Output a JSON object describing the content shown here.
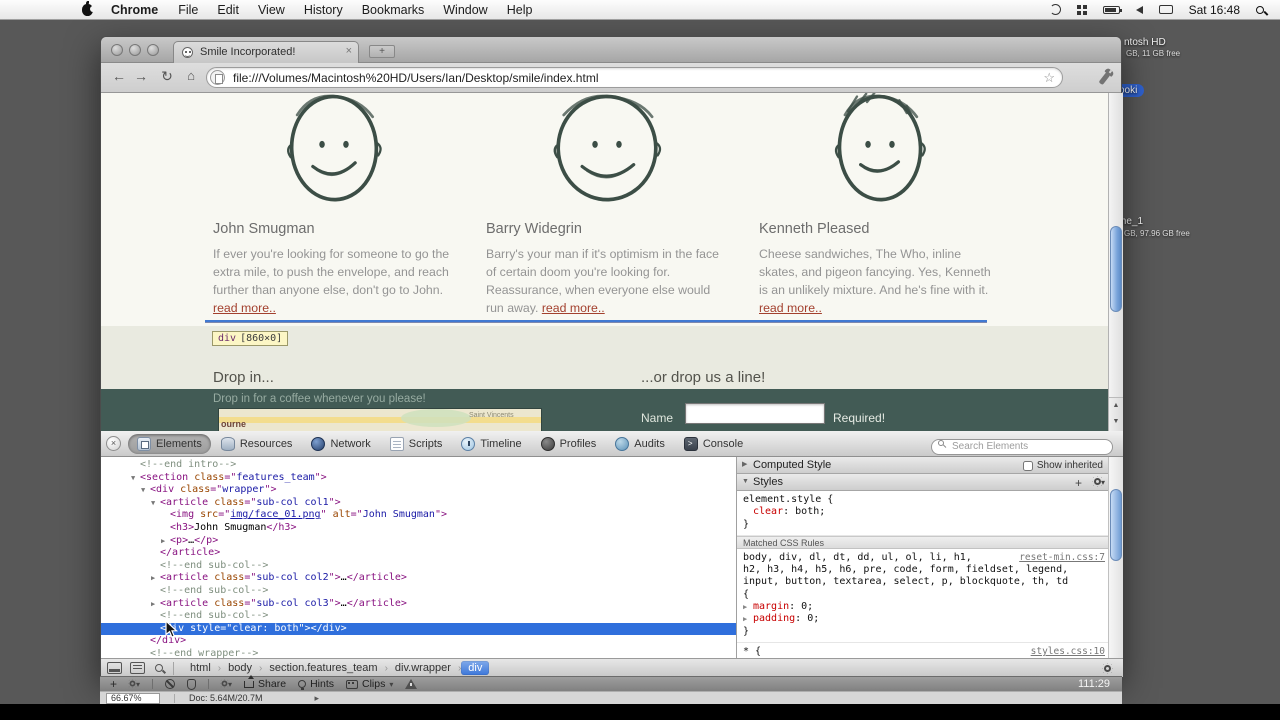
{
  "menubar": {
    "app": "Chrome",
    "menus": [
      "File",
      "Edit",
      "View",
      "History",
      "Bookmarks",
      "Window",
      "Help"
    ],
    "clock": "Sat 16:48"
  },
  "desktop": {
    "disk_top_label": "ntosh HD",
    "disk_top_info": "GB, 11 GB free",
    "selected_file_label": "ooki",
    "disk_bottom_label": "me_1",
    "disk_bottom_info": "GB, 97.96 GB free"
  },
  "window": {
    "tab_title": "Smile Incorporated!",
    "url": "file:///Volumes/Macintosh%20HD/Users/Ian/Desktop/smile/index.html"
  },
  "nav": {
    "back": "←",
    "forward": "→",
    "reload": "↻",
    "home": "⌂",
    "star": "☆"
  },
  "page": {
    "team": [
      {
        "name": "John Smugman",
        "bio": "If ever you're looking for someone to go the extra mile, to push the envelope, and reach further than anyone else, don't go to John. ",
        "more": "read more.."
      },
      {
        "name": "Barry Widegrin",
        "bio": "Barry's your man if it's optimism in the face of certain doom you're looking for. Reassurance, when everyone else would run away. ",
        "more": "read more.."
      },
      {
        "name": "Kenneth Pleased",
        "bio": "Cheese sandwiches, The Who, inline skates, and pigeon fancying. Yes, Kenneth is an unlikely mixture. And he's fine with it. ",
        "more": "read more.."
      }
    ],
    "highlight_tooltip": {
      "tag": "div",
      "size": "[860×0]"
    },
    "contact": {
      "left_heading": "Drop in...",
      "right_heading": "...or drop us a line!",
      "left_subtext": "Drop in for a coffee whenever you please!",
      "map_label_1": "Saint Vincents",
      "map_label_2": "ourne",
      "form_name_label": "Name",
      "form_required": "Required!"
    }
  },
  "devtools": {
    "tabs": [
      {
        "label": "Elements",
        "active": true
      },
      {
        "label": "Resources"
      },
      {
        "label": "Network"
      },
      {
        "label": "Scripts"
      },
      {
        "label": "Timeline"
      },
      {
        "label": "Profiles"
      },
      {
        "label": "Audits"
      },
      {
        "label": "Console"
      }
    ],
    "search_placeholder": "Search Elements",
    "tree": [
      {
        "i": 0,
        "p": [
          [
            "c",
            "<!--end intro-->"
          ]
        ]
      },
      {
        "i": 0,
        "a": "o",
        "p": [
          [
            "u",
            "<"
          ],
          [
            "g",
            "section"
          ],
          [
            "t",
            " "
          ],
          [
            "a",
            "class"
          ],
          [
            "u",
            "=\""
          ],
          [
            "v",
            "features_team"
          ],
          [
            "u",
            "\">"
          ]
        ]
      },
      {
        "i": 1,
        "a": "o",
        "p": [
          [
            "u",
            "<"
          ],
          [
            "g",
            "div"
          ],
          [
            "t",
            " "
          ],
          [
            "a",
            "class"
          ],
          [
            "u",
            "=\""
          ],
          [
            "v",
            "wrapper"
          ],
          [
            "u",
            "\">"
          ]
        ]
      },
      {
        "i": 2,
        "a": "o",
        "p": [
          [
            "u",
            "<"
          ],
          [
            "g",
            "article"
          ],
          [
            "t",
            " "
          ],
          [
            "a",
            "class"
          ],
          [
            "u",
            "=\""
          ],
          [
            "v",
            "sub-col col1"
          ],
          [
            "u",
            "\">"
          ]
        ]
      },
      {
        "i": 3,
        "p": [
          [
            "u",
            "<"
          ],
          [
            "g",
            "img"
          ],
          [
            "t",
            " "
          ],
          [
            "a",
            "src"
          ],
          [
            "u",
            "=\""
          ],
          [
            "l",
            "img/face_01.png"
          ],
          [
            "u",
            "\" "
          ],
          [
            "a",
            "alt"
          ],
          [
            "u",
            "=\""
          ],
          [
            "v",
            "John Smugman"
          ],
          [
            "u",
            "\">"
          ]
        ]
      },
      {
        "i": 3,
        "p": [
          [
            "u",
            "<"
          ],
          [
            "g",
            "h3"
          ],
          [
            "u",
            ">"
          ],
          [
            "t",
            "John Smugman"
          ],
          [
            "u",
            "</"
          ],
          [
            "g",
            "h3"
          ],
          [
            "u",
            ">"
          ]
        ]
      },
      {
        "i": 3,
        "a": "c",
        "p": [
          [
            "u",
            "<"
          ],
          [
            "g",
            "p"
          ],
          [
            "u",
            ">"
          ],
          [
            "t",
            "…"
          ],
          [
            "u",
            "</"
          ],
          [
            "g",
            "p"
          ],
          [
            "u",
            ">"
          ]
        ]
      },
      {
        "i": 2,
        "p": [
          [
            "u",
            "</"
          ],
          [
            "g",
            "article"
          ],
          [
            "u",
            ">"
          ]
        ]
      },
      {
        "i": 2,
        "p": [
          [
            "c",
            "<!--end sub-col-->"
          ]
        ]
      },
      {
        "i": 2,
        "a": "c",
        "p": [
          [
            "u",
            "<"
          ],
          [
            "g",
            "article"
          ],
          [
            "t",
            " "
          ],
          [
            "a",
            "class"
          ],
          [
            "u",
            "=\""
          ],
          [
            "v",
            "sub-col col2"
          ],
          [
            "u",
            "\">"
          ],
          [
            "t",
            "…"
          ],
          [
            "u",
            "</"
          ],
          [
            "g",
            "article"
          ],
          [
            "u",
            ">"
          ]
        ]
      },
      {
        "i": 2,
        "p": [
          [
            "c",
            "<!--end sub-col-->"
          ]
        ]
      },
      {
        "i": 2,
        "a": "c",
        "p": [
          [
            "u",
            "<"
          ],
          [
            "g",
            "article"
          ],
          [
            "t",
            " "
          ],
          [
            "a",
            "class"
          ],
          [
            "u",
            "=\""
          ],
          [
            "v",
            "sub-col col3"
          ],
          [
            "u",
            "\">"
          ],
          [
            "t",
            "…"
          ],
          [
            "u",
            "</"
          ],
          [
            "g",
            "article"
          ],
          [
            "u",
            ">"
          ]
        ]
      },
      {
        "i": 2,
        "p": [
          [
            "c",
            "<!--end sub-col-->"
          ]
        ]
      },
      {
        "i": 2,
        "s": true,
        "p": [
          [
            "u",
            "<"
          ],
          [
            "g",
            "div"
          ],
          [
            "t",
            " "
          ],
          [
            "a",
            "style"
          ],
          [
            "u",
            "=\""
          ],
          [
            "v",
            "clear: both"
          ],
          [
            "u",
            "\">"
          ],
          [
            "u",
            "</"
          ],
          [
            "g",
            "div"
          ],
          [
            "u",
            ">"
          ]
        ]
      },
      {
        "i": 1,
        "p": [
          [
            "u",
            "</"
          ],
          [
            "g",
            "div"
          ],
          [
            "u",
            ">"
          ]
        ]
      },
      {
        "i": 1,
        "p": [
          [
            "c",
            "<!--end wrapper-->"
          ]
        ]
      }
    ],
    "styles": {
      "computed_header": "Computed Style",
      "show_inherited": "Show inherited",
      "styles_header": "Styles",
      "matched_header": "Matched CSS Rules",
      "element_rule": {
        "selector_lines": [
          "element.style {"
        ],
        "props": [
          {
            "name": "clear",
            "value": "both"
          }
        ],
        "close": "}",
        "arrows": false,
        "source": null
      },
      "matched_rules": [
        {
          "selector_lines": [
            "body, div, dl, dt, dd, ul, ol, li, h1,",
            "h2, h3, h4, h5, h6, pre, code, form, fieldset, legend,",
            "input, button, textarea, select, p, blockquote, th, td",
            "{"
          ],
          "props": [
            {
              "name": "margin",
              "value": "0"
            },
            {
              "name": "padding",
              "value": "0"
            }
          ],
          "close": "}",
          "arrows": true,
          "source": "reset-min.css:7"
        },
        {
          "selector_lines": [
            "* {"
          ],
          "props": [],
          "close": null,
          "arrows": false,
          "source": "styles.css:10"
        }
      ]
    },
    "breadcrumbs": [
      {
        "label": "html"
      },
      {
        "label": "body"
      },
      {
        "label": "section.features_team"
      },
      {
        "label": "div.wrapper"
      },
      {
        "label": "div",
        "selected": true
      }
    ]
  },
  "player": {
    "labels": {
      "share": "Share",
      "hints": "Hints",
      "clips": "Clips"
    },
    "timer": "111:29"
  },
  "status": {
    "zoom": "66.67%",
    "doc": "Doc: 5.64M/20.7M"
  },
  "glyphs": {
    "open": "▼",
    "closed": "▶",
    "prop_arrow": "▶",
    "crumb_sep": "›",
    "close": "×",
    "plus": "+",
    "caret": "▾",
    "scroll_up": "▲",
    "scroll_down": "▼",
    "doc_arrow": "▸"
  }
}
